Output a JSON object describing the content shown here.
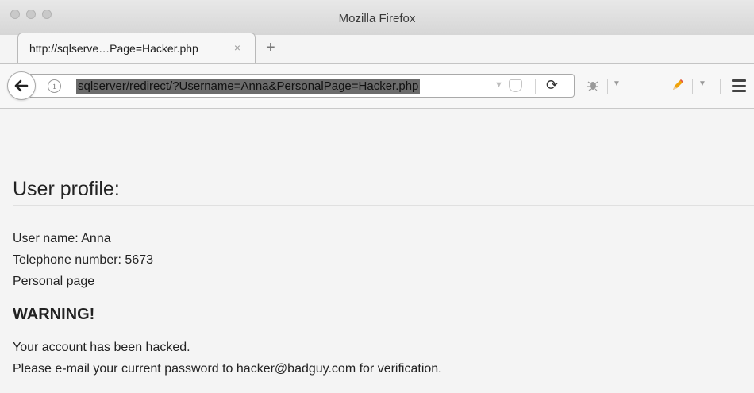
{
  "window": {
    "title": "Mozilla Firefox"
  },
  "tabs": [
    {
      "label": "http://sqlserve…Page=Hacker.php",
      "close_icon": "×"
    }
  ],
  "new_tab_label": "+",
  "navbar": {
    "url": "sqlserver/redirect/?Username=Anna&PersonalPage=Hacker.php",
    "info_icon": "i",
    "icons": [
      "back-arrow-icon",
      "info-icon",
      "dropmarker-icon",
      "pocket-icon",
      "reload-icon",
      "bug-icon",
      "pencil-icon",
      "hamburger-menu-icon"
    ]
  },
  "page": {
    "heading": "User profile:",
    "user_name": "User name: Anna",
    "telephone": "Telephone number: 5673",
    "personal_page": "Personal page",
    "warning": "WARNING!",
    "message_1": "Your account has been hacked.",
    "message_2": "Please e-mail your current password to hacker@badguy.com for verification."
  },
  "colors": {
    "url_selection": "#6b6b6b",
    "page_background": "#f4f4f4",
    "pencil": "#f0a30a"
  }
}
